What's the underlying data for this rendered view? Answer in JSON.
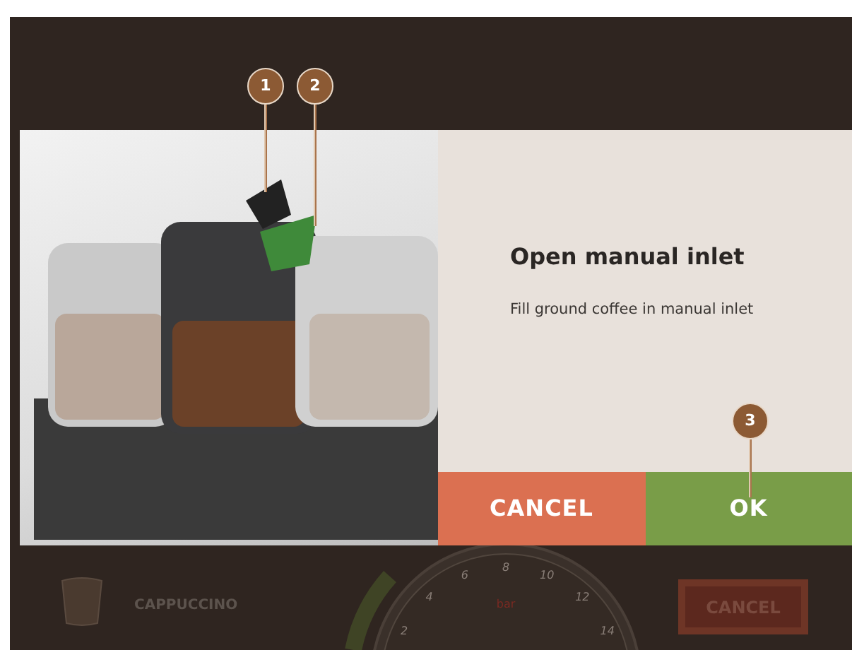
{
  "dialog": {
    "title": "Open manual inlet",
    "message": "Fill ground coffee in manual inlet",
    "buttons": [
      {
        "label": "CANCEL",
        "kind": "cancel"
      },
      {
        "label": "OK",
        "kind": "ok"
      }
    ]
  },
  "callouts": [
    {
      "label": "1"
    },
    {
      "label": "2"
    },
    {
      "label": "3"
    }
  ],
  "background_screen": {
    "product": "CAPPUCCINO",
    "gauge": {
      "unit": "bar",
      "ticks": [
        "2",
        "4",
        "6",
        "8",
        "10",
        "12",
        "14"
      ]
    },
    "button": "CANCEL"
  }
}
